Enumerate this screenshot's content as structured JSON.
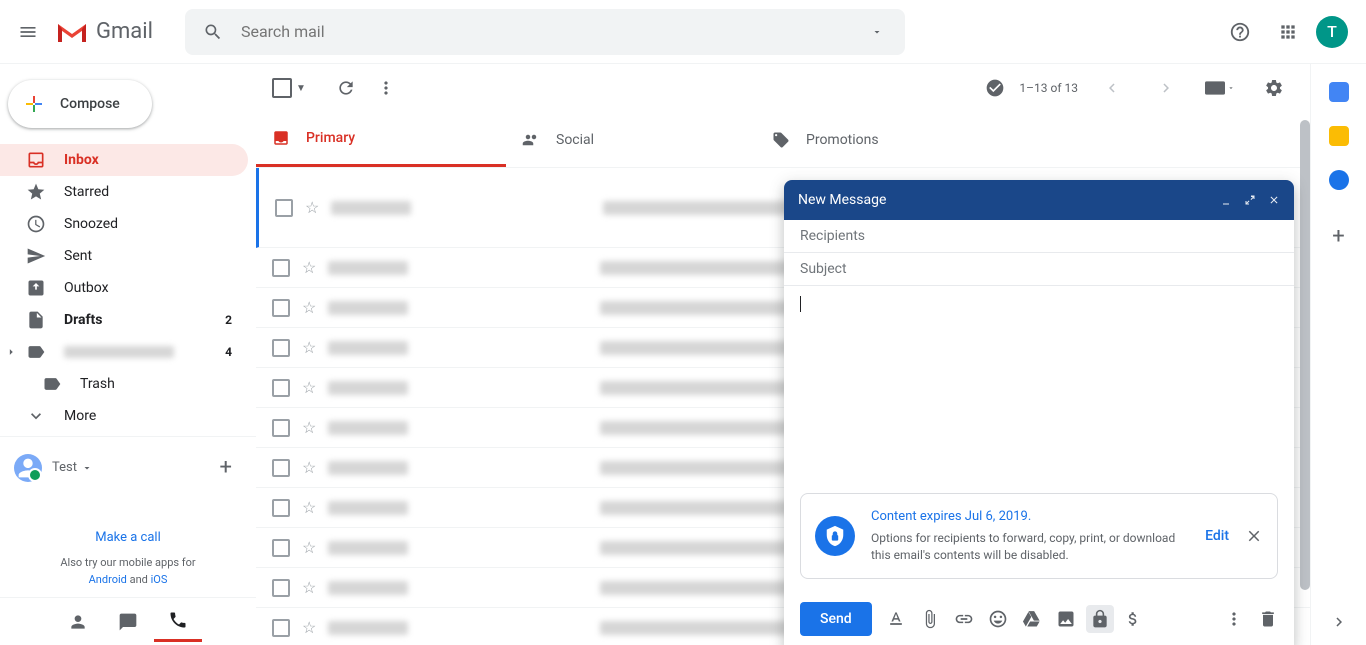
{
  "header": {
    "logo_text": "Gmail",
    "search_placeholder": "Search mail",
    "avatar_initial": "T"
  },
  "sidebar": {
    "compose_label": "Compose",
    "items": [
      {
        "label": "Inbox",
        "count": ""
      },
      {
        "label": "Starred",
        "count": ""
      },
      {
        "label": "Snoozed",
        "count": ""
      },
      {
        "label": "Sent",
        "count": ""
      },
      {
        "label": "Outbox",
        "count": ""
      },
      {
        "label": "Drafts",
        "count": "2"
      },
      {
        "label": "",
        "count": "4"
      },
      {
        "label": "Trash",
        "count": ""
      },
      {
        "label": "More",
        "count": ""
      }
    ],
    "hangouts_user": "Test",
    "make_call": "Make a call",
    "mobile_pre": "Also try our mobile apps for ",
    "mobile_android": "Android",
    "mobile_and": " and ",
    "mobile_ios": "iOS"
  },
  "toolbar": {
    "pagination": "1–13 of 13"
  },
  "tabs": {
    "primary": "Primary",
    "social": "Social",
    "promotions": "Promotions"
  },
  "compose": {
    "title": "New Message",
    "recipients": "Recipients",
    "subject": "Subject",
    "confidential": {
      "title": "Content expires Jul 6, 2019.",
      "body": "Options for recipients to forward, copy, print, or download this email's contents will be disabled.",
      "edit": "Edit"
    },
    "send": "Send"
  }
}
